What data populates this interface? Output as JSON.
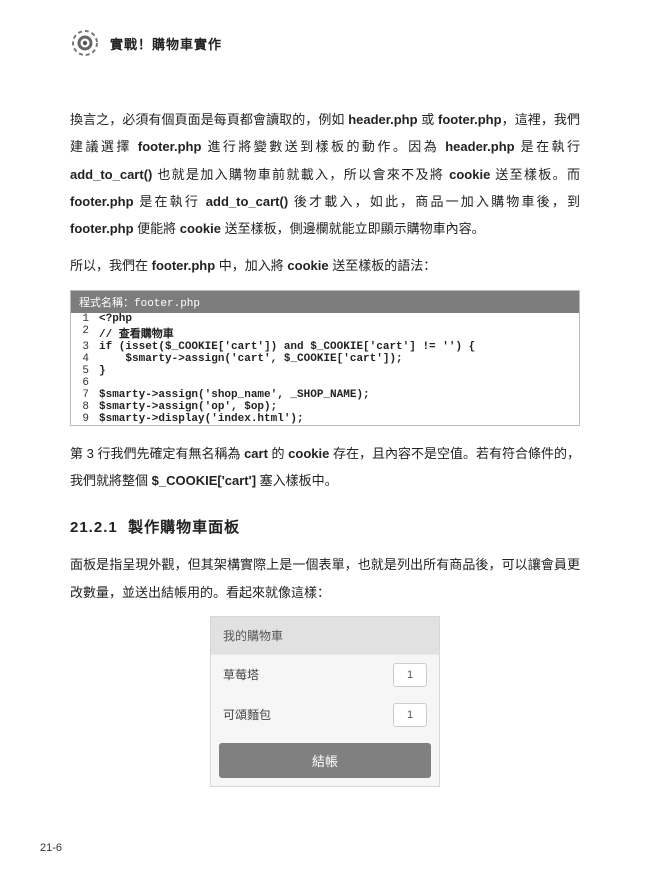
{
  "header": {
    "title": "實戰！購物車實作"
  },
  "body": {
    "p1_a": "換言之，必須有個頁面是每頁都會讀取的，例如 ",
    "p1_b": " 或 ",
    "p1_c": "，這裡，我們建議選擇 ",
    "p1_d": " 進行將變數送到樣板的動作。因為 ",
    "p1_e": " 是在執行 ",
    "p1_f": " 也就是加入購物車前就載入，所以會來不及將 ",
    "p1_g": " 送至樣板。而 ",
    "p1_h": " 是在執行 ",
    "p1_i": " 後才載入，如此，商品一加入購物車後，到 ",
    "p1_j": " 便能將 ",
    "p1_k": " 送至樣板，側邊欄就能立即顯示購物車內容。",
    "s_header": "header.php",
    "s_footer": "footer.php",
    "s_add": "add_to_cart()",
    "s_cookie": "cookie",
    "p2_a": "所以，我們在 ",
    "p2_b": " 中，加入將 ",
    "p2_c": " 送至樣板的語法：",
    "p3_a": "第 3 行我們先確定有無名稱為 ",
    "p3_cart": "cart",
    "p3_b": " 的 ",
    "p3_c": " 存在，且內容不是空值。若有符合條件的，我們就將整個 ",
    "p3_cookie_arr": "$_COOKIE['cart']",
    "p3_d": " 塞入樣板中。",
    "p4": "面板是指呈現外觀，但其架構實際上是一個表單，也就是列出所有商品後，可以讓會員更改數量，並送出結帳用的。看起來就像這樣："
  },
  "code": {
    "title_label": "程式名稱：",
    "filename": "footer.php",
    "lines": [
      "<?php",
      "// 查看購物車",
      "if (isset($_COOKIE['cart']) and $_COOKIE['cart'] != '') {",
      "    $smarty->assign('cart', $_COOKIE['cart']);",
      "}",
      "",
      "$smarty->assign('shop_name', _SHOP_NAME);",
      "$smarty->assign('op', $op);",
      "$smarty->display('index.html');"
    ]
  },
  "section": {
    "num": "21.2.1",
    "title": "製作購物車面板"
  },
  "cart": {
    "title": "我的購物車",
    "items": [
      {
        "name": "草莓塔",
        "qty": "1"
      },
      {
        "name": "可頌麵包",
        "qty": "1"
      }
    ],
    "checkout": "結帳"
  },
  "pagenum": "21-6"
}
